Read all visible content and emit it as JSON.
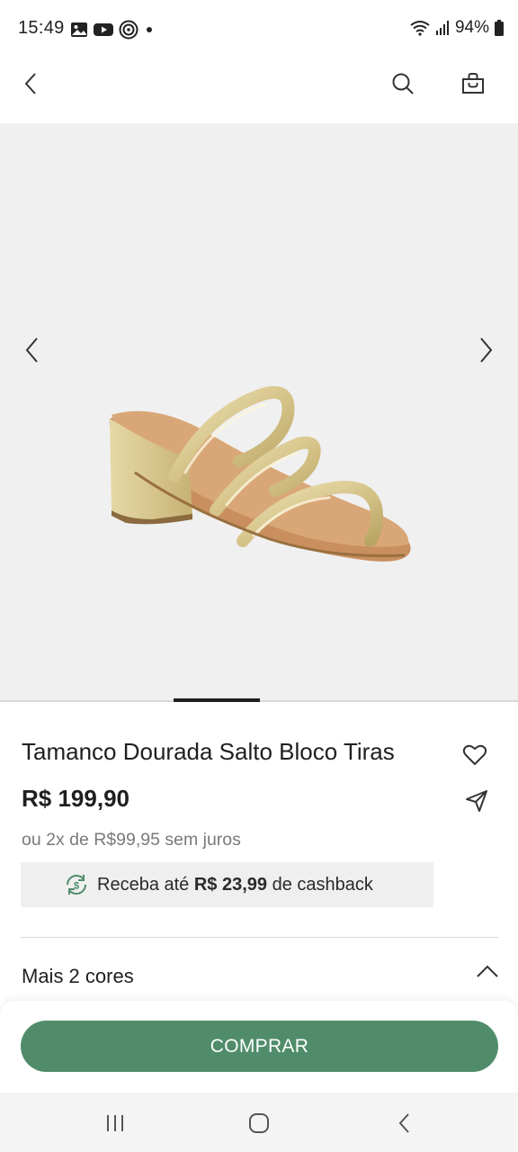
{
  "status_bar": {
    "time": "15:49",
    "battery": "94%",
    "icons": [
      "image-icon",
      "youtube-icon",
      "app-icon",
      "dot-icon",
      "wifi-icon",
      "signal-icon",
      "battery-icon"
    ]
  },
  "app_bar": {
    "icons": [
      "back-icon",
      "search-icon",
      "bag-icon"
    ]
  },
  "product": {
    "title": "Tamanco Dourada Salto Bloco Tiras",
    "price": "R$ 199,90",
    "installments": "ou 2x de R$99,95 sem juros",
    "cashback": {
      "prefix": "Receba até ",
      "amount": "R$ 23,99",
      "suffix": " de cashback"
    },
    "colors_label": "Mais 2 cores"
  },
  "actions": {
    "buy_label": "COMPRAR"
  },
  "colors": {
    "accent": "#508c6a",
    "gallery_bg": "#f0f0f0",
    "cashback_bg": "#efefef",
    "muted_text": "#7a7a7a"
  }
}
